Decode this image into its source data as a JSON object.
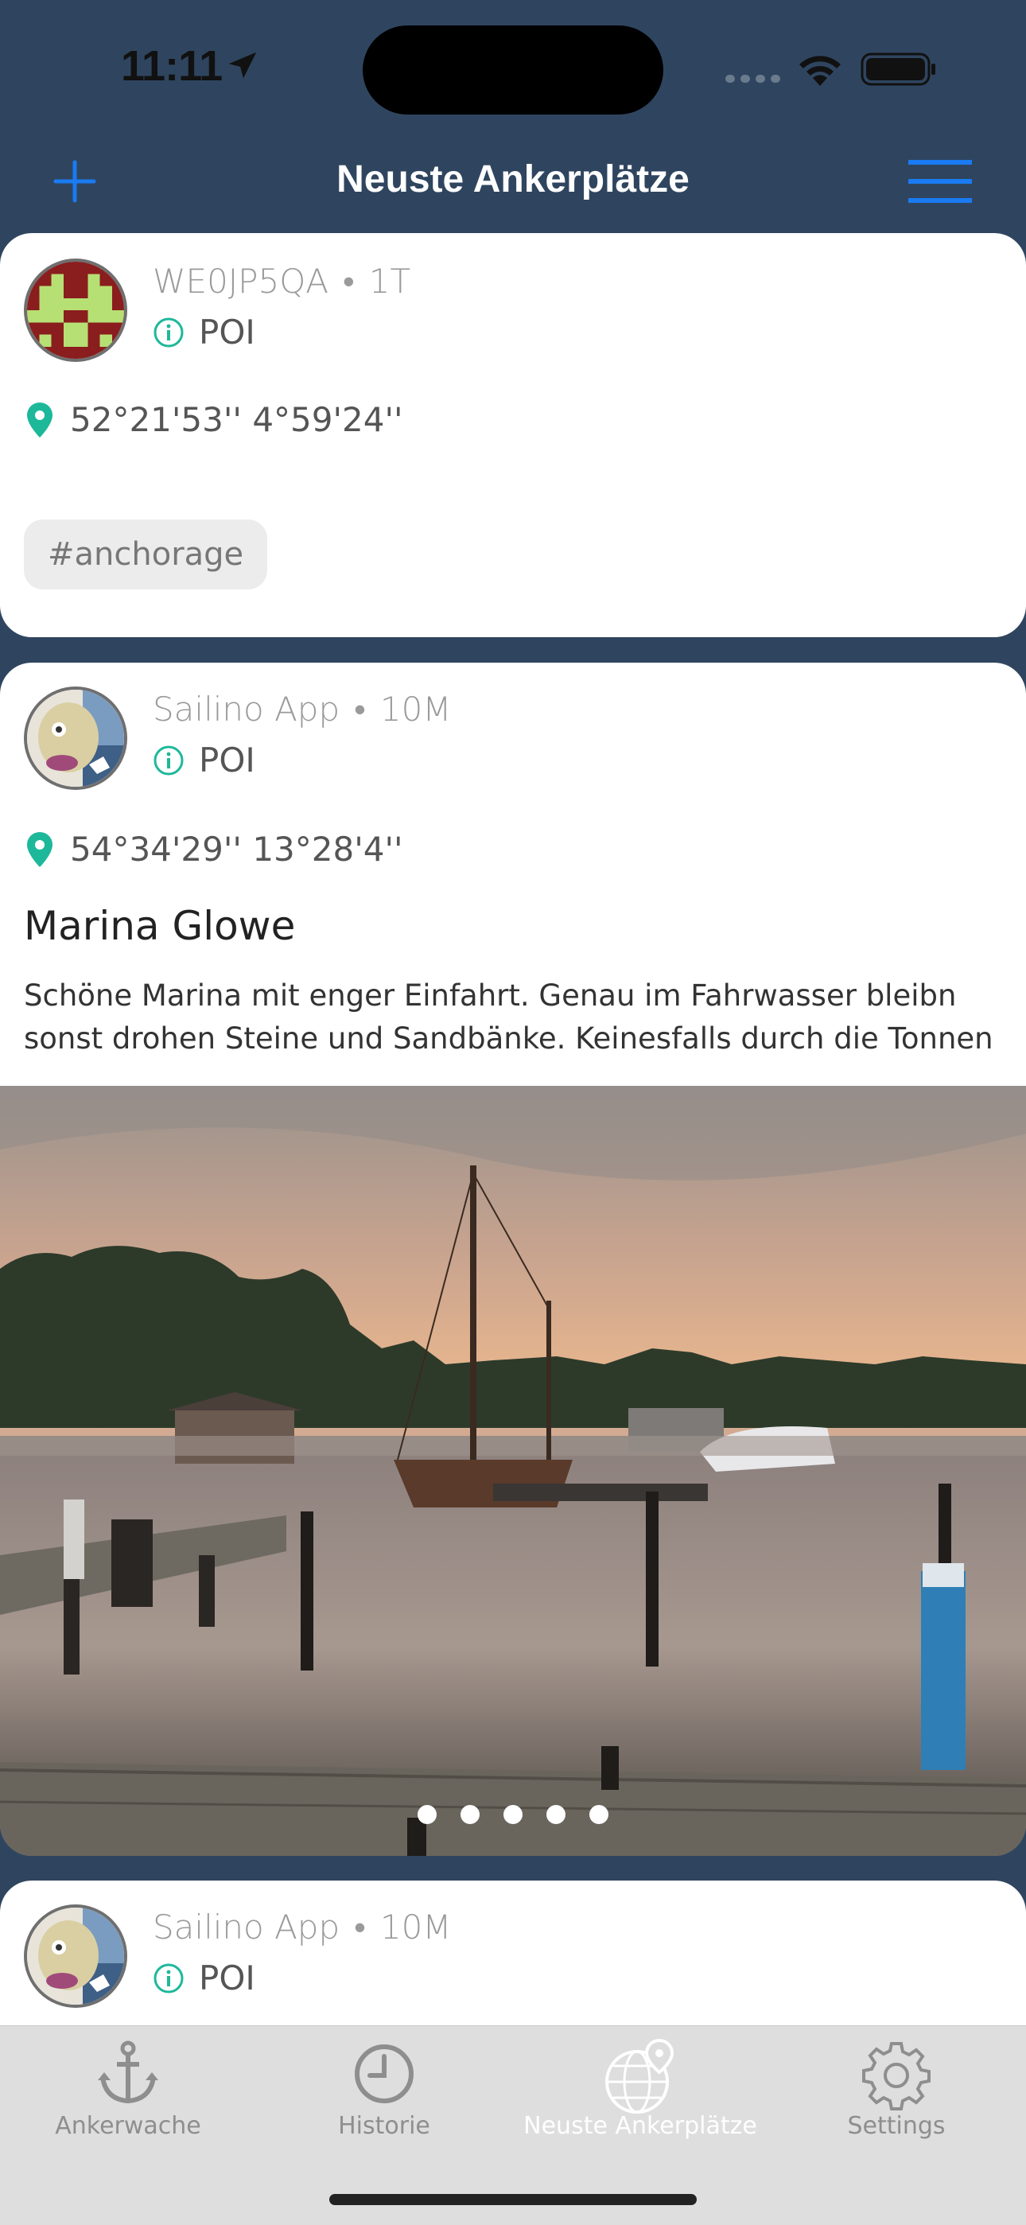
{
  "status_bar": {
    "time": "11:11"
  },
  "nav": {
    "title": "Neuste Ankerplätze",
    "add_icon": "plus-icon",
    "menu_icon": "hamburger-menu-icon",
    "accent": "#1a7bf2"
  },
  "posts": [
    {
      "author": "WE0JP5QA",
      "age": "1T",
      "type": "POI",
      "coords": "52°21'53'' 4°59'24''",
      "tag": "#anchorage"
    },
    {
      "author": "Sailino App",
      "age": "10M",
      "type": "POI",
      "coords": "54°34'29'' 13°28'4''",
      "title": "Marina Glowe",
      "text": "Schöne Marina mit enger Einfahrt. Genau im Fahrwasser bleibn sonst drohen Steine und Sandbänke. Keinesfalls durch die Tonnen",
      "photo_pages": 5
    },
    {
      "author": "Sailino App",
      "age": "10M",
      "type": "POI"
    }
  ],
  "tabs": [
    {
      "label": "Ankerwache",
      "icon": "anchor-icon"
    },
    {
      "label": "Historie",
      "icon": "clock-icon"
    },
    {
      "label": "Neuste Ankerplätze",
      "icon": "globe-pin-icon",
      "active": true
    },
    {
      "label": "Settings",
      "icon": "gear-icon"
    }
  ],
  "colors": {
    "header_bg": "#2f455f",
    "pin": "#1db89a",
    "tabbar_bg": "#dedede"
  }
}
